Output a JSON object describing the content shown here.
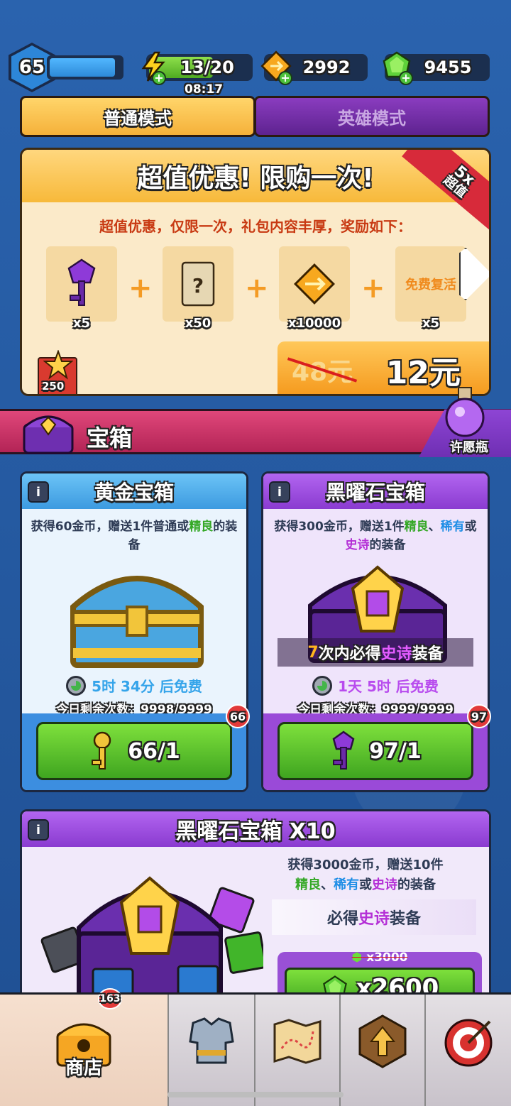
{
  "top_bar": {
    "level": "65",
    "energy": "13/20",
    "energy_timer": "08:17",
    "energy_progress": 0.65,
    "gold": "2992",
    "gems": "9455"
  },
  "modes": {
    "normal": "普通模式",
    "hero": "英雄模式"
  },
  "offer": {
    "title": "超值优惠! 限购一次!",
    "ribbon_top": "5x",
    "ribbon_bottom": "超值",
    "subtitle": "超值优惠，仅限一次，礼包内容丰厚，奖励如下：",
    "items": [
      {
        "name": "key",
        "qty": "x5"
      },
      {
        "name": "scroll",
        "qty": "x50"
      },
      {
        "name": "gold",
        "qty": "x10000"
      },
      {
        "name": "revive",
        "label": "免费复活",
        "qty": "x5"
      }
    ],
    "old_price": "48元",
    "new_price": "12元",
    "star_points": "250"
  },
  "treasure": {
    "title": "宝箱",
    "wish_label": "许愿瓶"
  },
  "gold_chest": {
    "title": "黄金宝箱",
    "desc_1": "获得60金币，赠送1件普通或",
    "desc_green": "精良",
    "desc_2": "的装备",
    "free_timer": "5时 34分 后免费",
    "remaining": "今日剩余次数：9998/9999",
    "badge": "66",
    "price": "66/1"
  },
  "obsidian_chest": {
    "title": "黑曜石宝箱",
    "desc_1": "获得300金币，赠送1件",
    "desc_green": "精良",
    "desc_sep": "、",
    "desc_blue": "稀有",
    "desc_or": "或",
    "desc_purple": "史诗",
    "desc_2": "的装备",
    "guarantee_num": "7",
    "guarantee_pre": "次内必得",
    "guarantee_epic": "史诗",
    "guarantee_post": "装备",
    "free_timer": "1天 5时 后免费",
    "remaining": "今日剩余次数：9999/9999",
    "badge": "97",
    "price": "97/1"
  },
  "obsidian_x10": {
    "title": "黑曜石宝箱 X10",
    "desc_1": "获得3000金币，赠送10件",
    "desc_green": "精良",
    "desc_sep": "、",
    "desc_blue": "稀有",
    "desc_or": "或",
    "desc_purple": "史诗",
    "desc_2": "的装备",
    "guarantee_pre": "必得",
    "guarantee_epic": "史诗",
    "guarantee_post": "装备",
    "old_price": "x3000",
    "price": "x2600"
  },
  "nav": {
    "shop_label": "商店",
    "shop_badge": "163",
    "items": [
      "shop",
      "armor",
      "map",
      "upgrade",
      "target"
    ]
  }
}
